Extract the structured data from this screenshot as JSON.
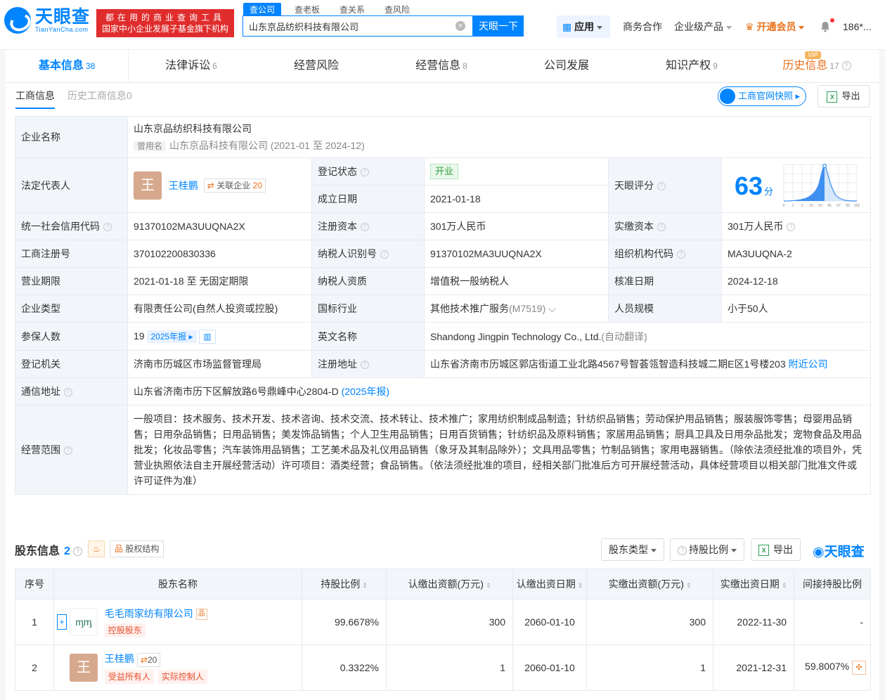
{
  "header": {
    "logo_cn": "天眼查",
    "logo_en": "TianYanCha.com",
    "slogan_line1": "都在用的商业查询工具",
    "slogan_line2": "国家中小企业发展子基金旗下机构",
    "search_tabs": [
      "查公司",
      "查老板",
      "查关系",
      "查风险"
    ],
    "search_value": "山东京品纺织科技有限公司",
    "search_button": "天眼一下",
    "nav_app": "应用",
    "nav_business": "商务合作",
    "nav_enterprise": "企业级产品",
    "nav_vip": "开通会员",
    "nav_user": "186*..."
  },
  "tabs": [
    {
      "label": "基本信息",
      "count": "38"
    },
    {
      "label": "法律诉讼",
      "count": "6"
    },
    {
      "label": "经营风险",
      "count": ""
    },
    {
      "label": "经营信息",
      "count": "8"
    },
    {
      "label": "公司发展",
      "count": ""
    },
    {
      "label": "知识产权",
      "count": "9"
    },
    {
      "label": "历史信息",
      "count": "17",
      "badge": "VIP"
    }
  ],
  "subtabs": {
    "current": "工商信息",
    "history": "历史工商信息0"
  },
  "buttons": {
    "snapshot": "工商官网快照",
    "export": "导出"
  },
  "info": {
    "company_name_label": "企业名称",
    "company_name": "山东京品纺织科技有限公司",
    "former_name_tag": "曾用名",
    "former_name": "山东京品科技有限公司 (2021-01 至 2024-12)",
    "legal_rep_label": "法定代表人",
    "legal_rep_avatar": "王",
    "legal_rep_name": "王桂鹏",
    "related_label": "关联企业",
    "related_count": "20",
    "reg_status_label": "登记状态",
    "reg_status": "开业",
    "found_date_label": "成立日期",
    "found_date": "2021-01-18",
    "score_label": "天眼评分",
    "score": "63",
    "score_unit": "分",
    "score_axis": [
      "0",
      "1",
      "3",
      "15",
      "50",
      "85",
      "97",
      "99",
      "100"
    ],
    "credit_code_label": "统一社会信用代码",
    "credit_code": "91370102MA3UUQNA2X",
    "reg_capital_label": "注册资本",
    "reg_capital": "301万人民币",
    "paid_capital_label": "实缴资本",
    "paid_capital": "301万人民币",
    "biz_reg_no_label": "工商注册号",
    "biz_reg_no": "370102200830336",
    "taxpayer_id_label": "纳税人识别号",
    "taxpayer_id": "91370102MA3UUQNA2X",
    "org_code_label": "组织机构代码",
    "org_code": "MA3UUQNA-2",
    "term_label": "营业期限",
    "term": "2021-01-18 至 无固定期限",
    "taxpayer_qual_label": "纳税人资质",
    "taxpayer_qual": "增值税一般纳税人",
    "approve_date_label": "核准日期",
    "approve_date": "2024-12-18",
    "type_label": "企业类型",
    "type": "有限责任公司(自然人投资或控股)",
    "industry_label": "国标行业",
    "industry": "其他技术推广服务",
    "industry_code": "(M7519)",
    "staff_label": "人员规模",
    "staff": "小于50人",
    "insured_label": "参保人数",
    "insured": "19",
    "insured_report": "2025年报",
    "en_name_label": "英文名称",
    "en_name": "Shandong Jingpin Technology Co., Ltd.",
    "en_name_note": "(自动翻译)",
    "authority_label": "登记机关",
    "authority": "济南市历城区市场监督管理局",
    "reg_addr_label": "注册地址",
    "reg_addr": "山东省济南市历城区郭店街道工业北路4567号智荟瓴智造科技城二期E区1号楼203",
    "nearby": "附近公司",
    "mail_addr_label": "通信地址",
    "mail_addr": "山东省济南市历下区解放路6号鼎峰中心2804-D",
    "mail_addr_src": "(2025年报)",
    "scope_label": "经营范围",
    "scope": "一般项目：技术服务、技术开发、技术咨询、技术交流、技术转让、技术推广；家用纺织制成品制造；针纺织品销售；劳动保护用品销售；服装服饰零售；母婴用品销售；日用杂品销售；日用品销售；美发饰品销售；个人卫生用品销售；日用百货销售；针纺织品及原料销售；家居用品销售；厨具卫具及日用杂品批发；宠物食品及用品批发；化妆品零售；汽车装饰用品销售；工艺美术品及礼仪用品销售（象牙及其制品除外）；文具用品零售；竹制品销售；家用电器销售。（除依法须经批准的项目外，凭营业执照依法自主开展经营活动）许可项目：酒类经营；食品销售。（依法须经批准的项目，经相关部门批准后方可开展经营活动，具体经营项目以相关部门批准文件或许可证件为准）"
  },
  "shareholders": {
    "title": "股东信息",
    "count": "2",
    "structure_btn": "股权结构",
    "type_btn": "股东类型",
    "ratio_btn": "持股比例",
    "export_btn": "导出",
    "brand": "天眼查",
    "columns": [
      "序号",
      "股东名称",
      "持股比例",
      "认缴出资额(万元)",
      "认缴出资日期",
      "实缴出资额(万元)",
      "实缴出资日期",
      "间接持股比例"
    ],
    "rows": [
      {
        "no": "1",
        "name": "毛毛雨家纺有限公司",
        "logo_text": "ᶆᶆ",
        "tags": [
          "控股股东"
        ],
        "related": "",
        "ratio": "99.6678%",
        "sub_amt": "300",
        "sub_date": "2060-01-10",
        "paid_amt": "300",
        "paid_date": "2022-11-30",
        "indirect": "-"
      },
      {
        "no": "2",
        "name": "王桂鹏",
        "avatar": "王",
        "related": "20",
        "tags": [
          "受益所有人",
          "实际控制人"
        ],
        "ratio": "0.3322%",
        "sub_amt": "1",
        "sub_date": "2060-01-10",
        "paid_amt": "1",
        "paid_date": "2021-12-31",
        "indirect": "59.8007%"
      }
    ]
  },
  "colors": {
    "brand": "#0084ff",
    "accent": "#e8731f",
    "slogan_bg": "#e02c2c"
  }
}
